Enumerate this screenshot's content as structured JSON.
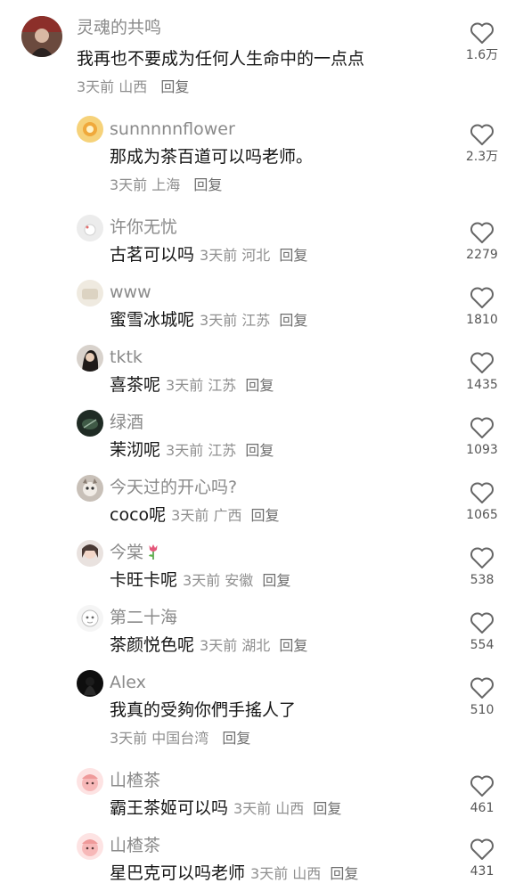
{
  "comments": [
    {
      "name": "灵魂的共鸣",
      "text": "我再也不要成为任何人生命中的一点点",
      "time": "3天前",
      "region": "山西",
      "reply": "回复",
      "likes": "1.6万"
    },
    {
      "name": "sunnnnnflower",
      "text": "那成为茶百道可以吗老师。",
      "time": "3天前",
      "region": "上海",
      "reply": "回复",
      "likes": "2.3万"
    },
    {
      "name": "许你无忧",
      "text": "古茗可以吗",
      "time": "3天前",
      "region": "河北",
      "reply": "回复",
      "likes": "2279"
    },
    {
      "name": "www",
      "text": "蜜雪冰城呢",
      "time": "3天前",
      "region": "江苏",
      "reply": "回复",
      "likes": "1810"
    },
    {
      "name": "tktk",
      "text": "喜茶呢",
      "time": "3天前",
      "region": "江苏",
      "reply": "回复",
      "likes": "1435"
    },
    {
      "name": "绿酒",
      "text": "茉沏呢",
      "time": "3天前",
      "region": "江苏",
      "reply": "回复",
      "likes": "1093"
    },
    {
      "name": "今天过的开心吗?",
      "text": "coco呢",
      "time": "3天前",
      "region": "广西",
      "reply": "回复",
      "likes": "1065"
    },
    {
      "name": "今棠",
      "text": "卡旺卡呢",
      "time": "3天前",
      "region": "安徽",
      "reply": "回复",
      "likes": "538"
    },
    {
      "name": "第二十海",
      "text": "茶颜悦色呢",
      "time": "3天前",
      "region": "湖北",
      "reply": "回复",
      "likes": "554"
    },
    {
      "name": "Alex",
      "text": "我真的受夠你們手搖人了",
      "time": "3天前",
      "region": "中国台湾",
      "reply": "回复",
      "likes": "510"
    },
    {
      "name": "山楂茶",
      "text": "霸王茶姬可以吗",
      "time": "3天前",
      "region": "山西",
      "reply": "回复",
      "likes": "461"
    },
    {
      "name": "山楂茶",
      "text": "星巴克可以吗老师",
      "time": "3天前",
      "region": "山西",
      "reply": "回复",
      "likes": "431"
    }
  ],
  "icons": {
    "like": "heart-outline-icon",
    "name_emoji": "tulip-emoji-icon"
  },
  "colors": {
    "name": "#8a8a8a",
    "meta": "#8f8f8f",
    "text": "#161616"
  }
}
